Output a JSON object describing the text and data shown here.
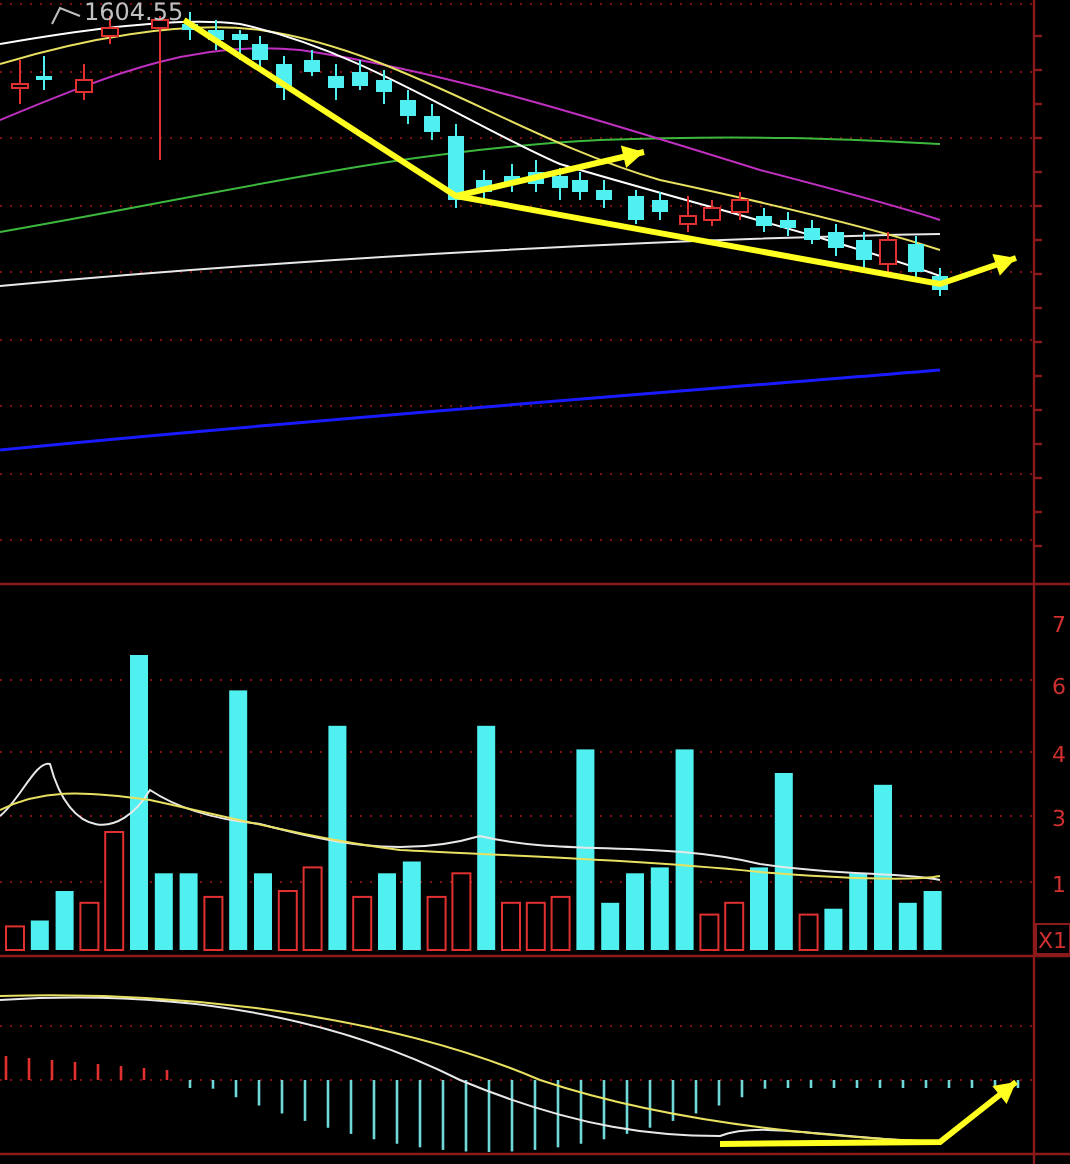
{
  "price_panel": {
    "high_label": "1604.55"
  },
  "volume_panel": {
    "axis_labels": [
      "7",
      "6",
      "4",
      "3",
      "1"
    ],
    "scale_label": "X1"
  }
}
